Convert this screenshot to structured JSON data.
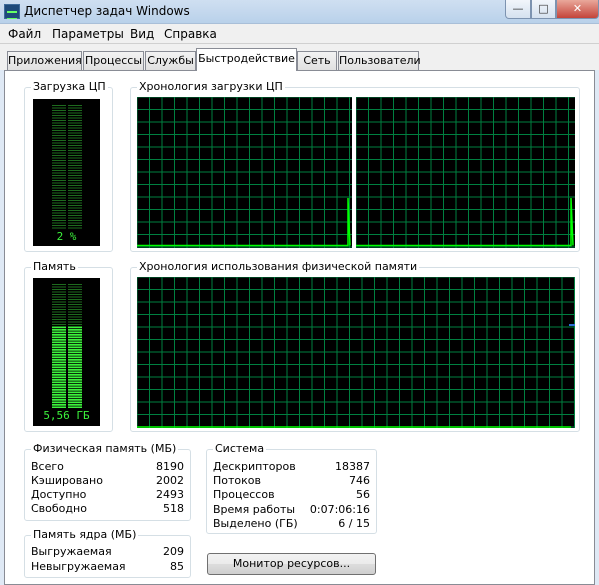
{
  "window": {
    "title": "Диспетчер задач Windows",
    "min_glyph": "—",
    "max_glyph": "□",
    "close_glyph": "✕"
  },
  "menu": [
    "Файл",
    "Параметры",
    "Вид",
    "Справка"
  ],
  "tabs": [
    "Приложения",
    "Процессы",
    "Службы",
    "Быстродействие",
    "Сеть",
    "Пользователи"
  ],
  "active_tab": "Быстродействие",
  "cpu": {
    "group_label": "Загрузка ЦП",
    "value_text": "2 %",
    "usage_fraction": 0.02,
    "history_label": "Хронология загрузки ЦП"
  },
  "memory": {
    "group_label": "Память",
    "value_text": "5,56 ГБ",
    "usage_fraction": 0.68,
    "history_label": "Хронология использования физической памяти"
  },
  "physical_memory": {
    "group_label": "Физическая память (МБ)",
    "rows": [
      {
        "label": "Всего",
        "value": "8190"
      },
      {
        "label": "Кэшировано",
        "value": "2002"
      },
      {
        "label": "Доступно",
        "value": "2493"
      },
      {
        "label": "Свободно",
        "value": "518"
      }
    ]
  },
  "kernel_memory": {
    "group_label": "Память ядра (МБ)",
    "rows": [
      {
        "label": "Выгружаемая",
        "value": "209"
      },
      {
        "label": "Невыгружаемая",
        "value": "85"
      }
    ]
  },
  "system": {
    "group_label": "Система",
    "rows": [
      {
        "label": "Дескрипторов",
        "value": "18387"
      },
      {
        "label": "Потоков",
        "value": "746"
      },
      {
        "label": "Процессов",
        "value": "56"
      },
      {
        "label": "Время работы",
        "value": "0:07:06:16"
      },
      {
        "label": "Выделено (ГБ)",
        "value": "6 / 15"
      }
    ]
  },
  "resource_monitor_button": "Монитор ресурсов...",
  "colors": {
    "graph_bg": "#000000",
    "grid": "#008040",
    "trace": "#00ff00",
    "gauge_on": "#3cf23c",
    "gauge_off": "#1e6b1e"
  }
}
